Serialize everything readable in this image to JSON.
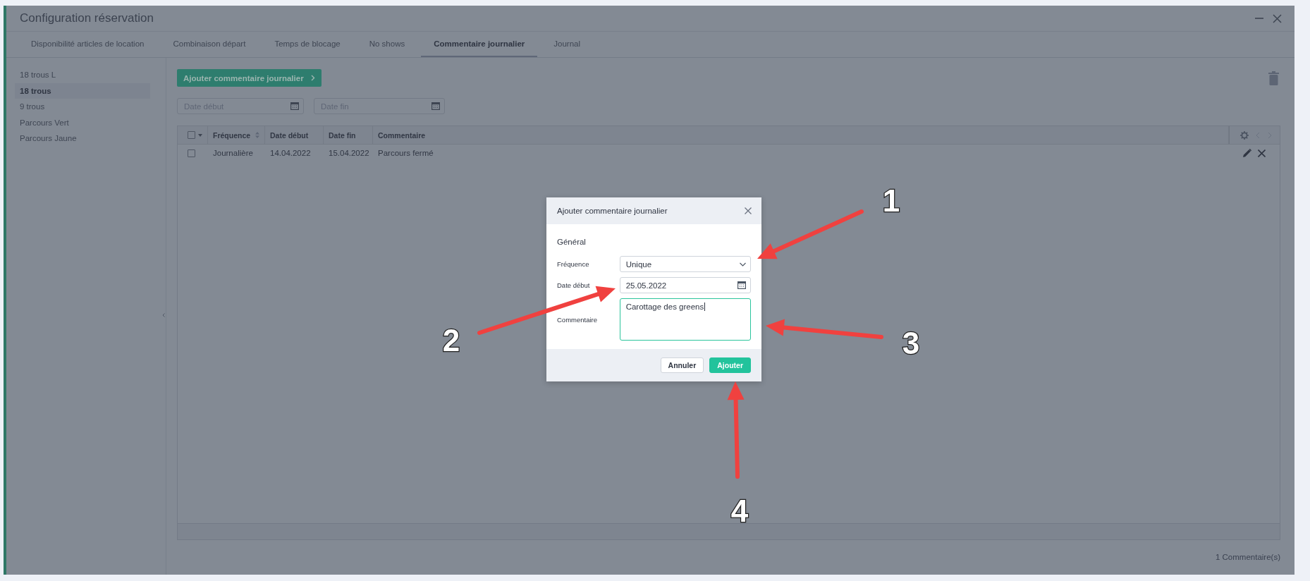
{
  "window": {
    "title": "Configuration réservation"
  },
  "tabs": [
    {
      "label": "Disponibilité articles de location",
      "selected": false
    },
    {
      "label": "Combinaison départ",
      "selected": false
    },
    {
      "label": "Temps de blocage",
      "selected": false
    },
    {
      "label": "No shows",
      "selected": false
    },
    {
      "label": "Commentaire journalier",
      "selected": true
    },
    {
      "label": "Journal",
      "selected": false
    }
  ],
  "sidebar": {
    "items": [
      {
        "label": "18 trous L",
        "selected": false
      },
      {
        "label": "18 trous",
        "selected": true
      },
      {
        "label": "9 trous",
        "selected": false
      },
      {
        "label": "Parcours Vert",
        "selected": false
      },
      {
        "label": "Parcours Jaune",
        "selected": false
      }
    ]
  },
  "toolbar": {
    "add_button": "Ajouter commentaire journalier",
    "date_start": {
      "placeholder": "Date début"
    },
    "date_end": {
      "placeholder": "Date fin"
    }
  },
  "table": {
    "header_checked": false,
    "columns": [
      {
        "label": "Fréquence",
        "sort_icon": true
      },
      {
        "label": "Date début",
        "sort_icon": false
      },
      {
        "label": "Date fin",
        "sort_icon": false
      },
      {
        "label": "Commentaire",
        "sort_icon": false
      }
    ],
    "rows": [
      {
        "checked": false,
        "cells": [
          "Journalière",
          "14.04.2022",
          "15.04.2022",
          "Parcours fermé"
        ]
      }
    ]
  },
  "footer": {
    "count": "1 Commentaire(s)"
  },
  "dialog": {
    "title": "Ajouter commentaire journalier",
    "section": "Général",
    "fields": [
      {
        "kind": "select",
        "label": "Fréquence",
        "value": "Unique"
      },
      {
        "kind": "date",
        "label": "Date début",
        "value": "25.05.2022"
      },
      {
        "kind": "textarea",
        "label": "Commentaire",
        "value": "Carottage des greens"
      }
    ],
    "buttons": [
      {
        "label": "Annuler",
        "kind": "secondary"
      },
      {
        "label": "Ajouter",
        "kind": "primary"
      }
    ]
  },
  "annotations": [
    {
      "number": "1"
    },
    {
      "number": "2"
    },
    {
      "number": "3"
    },
    {
      "number": "4"
    }
  ]
}
